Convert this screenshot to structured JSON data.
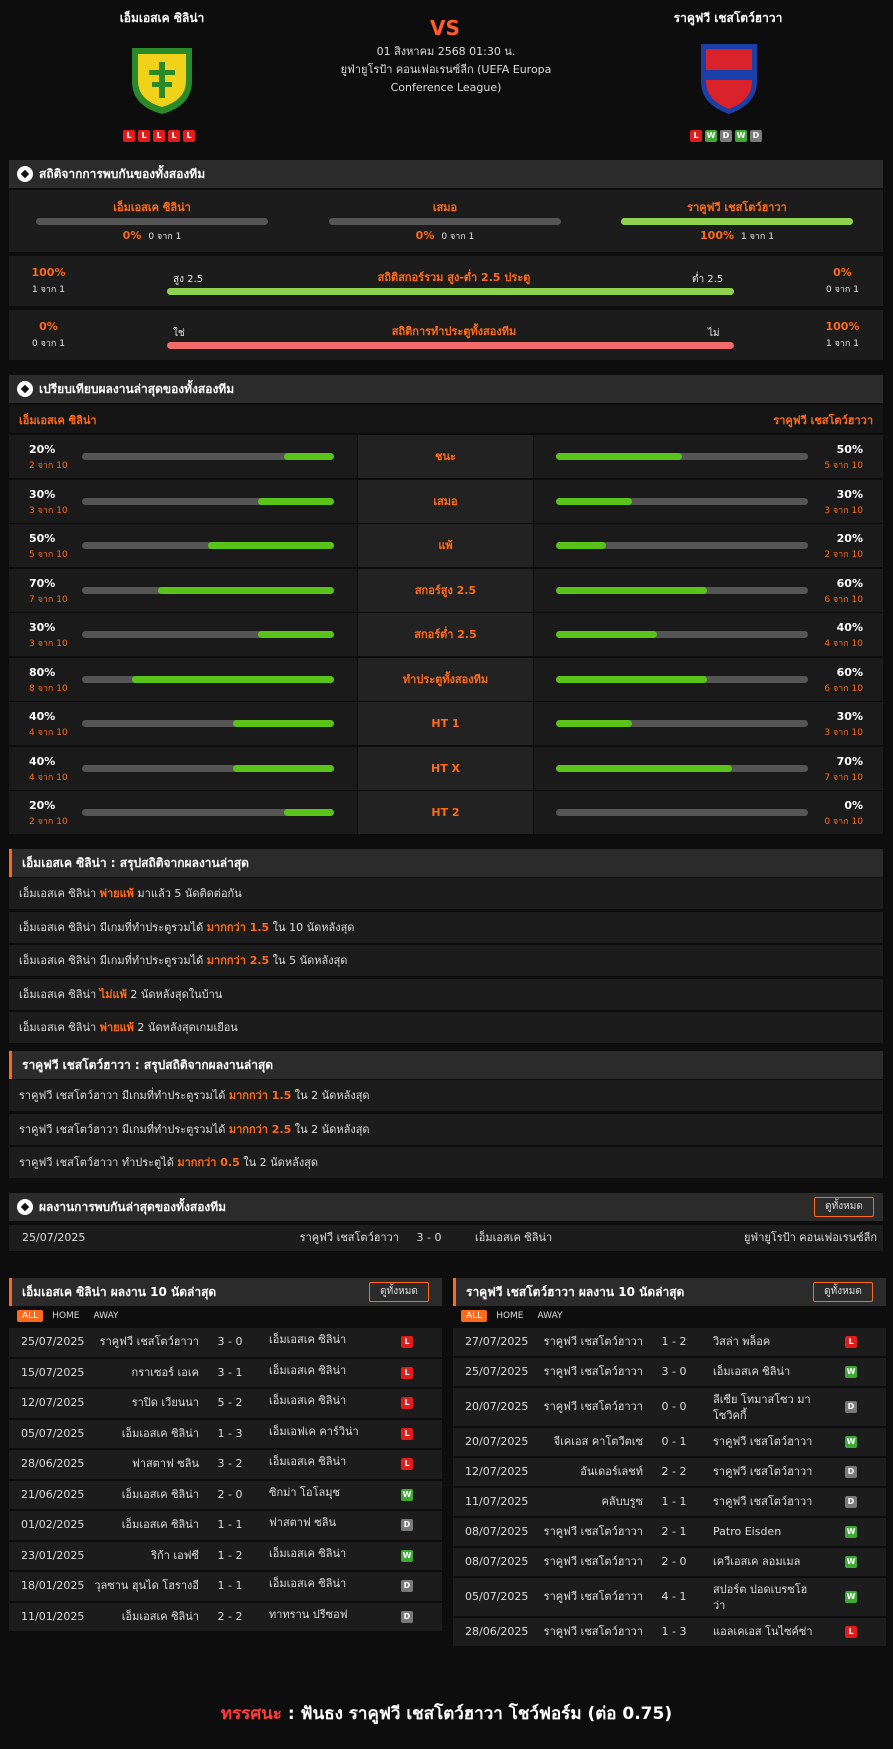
{
  "match": {
    "home": "เอ็มเอสเค ซิลิน่า",
    "away": "ราคูฟวี เชสโตว์ฮาวา",
    "vs": "VS",
    "date": "01 สิงหาคม 2568 01:30 น.",
    "competition": "ยูฟ่ายูโรป้า คอนเฟอเรนซ์ลีก (UEFA Europa Conference League)",
    "home_form": [
      "L",
      "L",
      "L",
      "L",
      "L"
    ],
    "away_form": [
      "L",
      "W",
      "D",
      "W",
      "D"
    ]
  },
  "h2h_stats": {
    "title": "สถิติจากการพบกันของทั้งสองทีม",
    "home": {
      "label": "เอ็มเอสเค ซิลิน่า",
      "pct": "0%",
      "of": "0 จาก 1",
      "value": 0
    },
    "draw": {
      "label": "เสมอ",
      "pct": "0%",
      "of": "0 จาก 1",
      "value": 0
    },
    "away": {
      "label": "ราคูฟวี เชสโตว์ฮาวา",
      "pct": "100%",
      "of": "1 จาก 1",
      "value": 1
    },
    "ou": {
      "title": "สถิติสกอร์รวม สูง-ต่ำ 2.5 ประตู",
      "left_label": "สูง 2.5",
      "right_label": "ต่ำ 2.5",
      "left_pct": "100%",
      "left_of": "1 จาก 1",
      "right_pct": "0%",
      "right_of": "0 จาก 1",
      "value": 1
    },
    "btts": {
      "title": "สถิติการทำประตูทั้งสองทีม",
      "left_label": "ใช่",
      "right_label": "ไม่",
      "left_pct": "0%",
      "left_of": "0 จาก 1",
      "right_pct": "100%",
      "right_of": "1 จาก 1",
      "value": 0
    }
  },
  "compare": {
    "title": "เปรียบเทียบผลงานล่าสุดของทั้งสองทีม",
    "home": "เอ็มเอสเค ซิลิน่า",
    "away": "ราคูฟวี เชสโตว์ฮาวา",
    "rows": [
      {
        "label": "ชนะ",
        "hp": "20%",
        "ho": "2 จาก 10",
        "hv": 0.2,
        "ap": "50%",
        "ao": "5 จาก 10",
        "av": 0.5
      },
      {
        "label": "เสมอ",
        "hp": "30%",
        "ho": "3 จาก 10",
        "hv": 0.3,
        "ap": "30%",
        "ao": "3 จาก 10",
        "av": 0.3
      },
      {
        "label": "แพ้",
        "hp": "50%",
        "ho": "5 จาก 10",
        "hv": 0.5,
        "ap": "20%",
        "ao": "2 จาก 10",
        "av": 0.2
      },
      {
        "label": "สกอร์สูง 2.5",
        "hp": "70%",
        "ho": "7 จาก 10",
        "hv": 0.7,
        "ap": "60%",
        "ao": "6 จาก 10",
        "av": 0.6
      },
      {
        "label": "สกอร์ต่ำ 2.5",
        "hp": "30%",
        "ho": "3 จาก 10",
        "hv": 0.3,
        "ap": "40%",
        "ao": "4 จาก 10",
        "av": 0.4
      },
      {
        "label": "ทำประตูทั้งสองทีม",
        "hp": "80%",
        "ho": "8 จาก 10",
        "hv": 0.8,
        "ap": "60%",
        "ao": "6 จาก 10",
        "av": 0.6
      },
      {
        "label": "HT 1",
        "hp": "40%",
        "ho": "4 จาก 10",
        "hv": 0.4,
        "ap": "30%",
        "ao": "3 จาก 10",
        "av": 0.3
      },
      {
        "label": "HT X",
        "hp": "40%",
        "ho": "4 จาก 10",
        "hv": 0.4,
        "ap": "70%",
        "ao": "7 จาก 10",
        "av": 0.7
      },
      {
        "label": "HT 2",
        "hp": "20%",
        "ho": "2 จาก 10",
        "hv": 0.2,
        "ap": "0%",
        "ao": "0 จาก 10",
        "av": 0
      }
    ]
  },
  "home_summary": {
    "title": "เอ็มเอสเค ซิลิน่า : สรุปสถิติจากผลงานล่าสุด",
    "rows": [
      {
        "pre": "เอ็มเอสเค ซิลิน่า ",
        "hl": "พ่ายแพ้",
        "post": " มาแล้ว 5 นัดติดต่อกัน"
      },
      {
        "pre": "เอ็มเอสเค ซิลิน่า มีเกมที่ทำประตูรวมได้ ",
        "hl": "มากกว่า 1.5",
        "post": " ใน 10 นัดหลังสุด"
      },
      {
        "pre": "เอ็มเอสเค ซิลิน่า มีเกมที่ทำประตูรวมได้ ",
        "hl": "มากกว่า 2.5",
        "post": " ใน 5 นัดหลังสุด"
      },
      {
        "pre": "เอ็มเอสเค ซิลิน่า ",
        "hl": "ไม่แพ้",
        "post": " 2 นัดหลังสุดในบ้าน"
      },
      {
        "pre": "เอ็มเอสเค ซิลิน่า ",
        "hl": "พ่ายแพ้",
        "post": " 2 นัดหลังสุดเกมเยือน"
      }
    ]
  },
  "away_summary": {
    "title": "ราคูฟวี เชสโตว์ฮาวา : สรุปสถิติจากผลงานล่าสุด",
    "rows": [
      {
        "pre": "ราคูฟวี เชสโตว์ฮาวา มีเกมที่ทำประตูรวมได้ ",
        "hl": "มากกว่า 1.5",
        "post": " ใน 2 นัดหลังสุด"
      },
      {
        "pre": "ราคูฟวี เชสโตว์ฮาวา มีเกมที่ทำประตูรวมได้ ",
        "hl": "มากกว่า 2.5",
        "post": " ใน 2 นัดหลังสุด"
      },
      {
        "pre": "ราคูฟวี เชสโตว์ฮาวา ทำประตูได้ ",
        "hl": "มากกว่า 0.5",
        "post": " ใน 2 นัดหลังสุด"
      }
    ]
  },
  "h2h": {
    "title": "ผลงานการพบกันล่าสุดของทั้งสองทีม",
    "view_all": "ดูทั้งหมด",
    "rows": [
      {
        "date": "25/07/2025",
        "home": "ราคูฟวี เชสโตว์ฮาวา",
        "score": "3 - 0",
        "away": "เอ็มเอสเค ซิลิน่า",
        "comp": "ยูฟ่ายูโรป้า คอนเฟอเรนซ์ลีก"
      }
    ]
  },
  "home_last10": {
    "title": "เอ็มเอสเค ซิลิน่า ผลงาน 10 นัดล่าสุด",
    "view_all": "ดูทั้งหมด",
    "tabs": [
      "ALL",
      "HOME",
      "AWAY"
    ],
    "rows": [
      {
        "date": "25/07/2025",
        "home": "ราคูฟวี เชสโตว์ฮาวา",
        "score": "3 - 0",
        "away": "เอ็มเอสเค ซิลิน่า",
        "res": "L"
      },
      {
        "date": "15/07/2025",
        "home": "กราเซอร์ เอเค",
        "score": "3 - 1",
        "away": "เอ็มเอสเค ซิลิน่า",
        "res": "L"
      },
      {
        "date": "12/07/2025",
        "home": "ราปิด เวียนนา",
        "score": "5 - 2",
        "away": "เอ็มเอสเค ซิลิน่า",
        "res": "L"
      },
      {
        "date": "05/07/2025",
        "home": "เอ็มเอสเค ซิลิน่า",
        "score": "1 - 3",
        "away": "เอ็มเอฟเค คาร์วิน่า",
        "res": "L"
      },
      {
        "date": "28/06/2025",
        "home": "ฟาสตาฟ ซลิน",
        "score": "3 - 2",
        "away": "เอ็มเอสเค ซิลิน่า",
        "res": "L"
      },
      {
        "date": "21/06/2025",
        "home": "เอ็มเอสเค ซิลิน่า",
        "score": "2 - 0",
        "away": "ซิกม่า โอโลมุช",
        "res": "W"
      },
      {
        "date": "01/02/2025",
        "home": "เอ็มเอสเค ซิลิน่า",
        "score": "1 - 1",
        "away": "ฟาสตาฟ ซลิน",
        "res": "D"
      },
      {
        "date": "23/01/2025",
        "home": "ริก้า เอฟซี",
        "score": "1 - 2",
        "away": "เอ็มเอสเค ซิลิน่า",
        "res": "W"
      },
      {
        "date": "18/01/2025",
        "home": "วุลซาน ฮุนได โฮรางอี",
        "score": "1 - 1",
        "away": "เอ็มเอสเค ซิลิน่า",
        "res": "D"
      },
      {
        "date": "11/01/2025",
        "home": "เอ็มเอสเค ซิลิน่า",
        "score": "2 - 2",
        "away": "ทาทราน ปรีซอฟ",
        "res": "D"
      }
    ]
  },
  "away_last10": {
    "title": "ราคูฟวี เชสโตว์ฮาวา ผลงาน 10 นัดล่าสุด",
    "view_all": "ดูทั้งหมด",
    "tabs": [
      "ALL",
      "HOME",
      "AWAY"
    ],
    "rows": [
      {
        "date": "27/07/2025",
        "home": "ราคูฟวี เชสโตว์ฮาวา",
        "score": "1 - 2",
        "away": "วิสล่า พล็อค",
        "res": "L"
      },
      {
        "date": "25/07/2025",
        "home": "ราคูฟวี เชสโตว์ฮาวา",
        "score": "3 - 0",
        "away": "เอ็มเอสเค ซิลิน่า",
        "res": "W"
      },
      {
        "date": "20/07/2025",
        "home": "ราคูฟวี เชสโตว์ฮาวา",
        "score": "0 - 0",
        "away": "ลีเซีย โทมาสโซว มาโซวิคกี้",
        "res": "D"
      },
      {
        "date": "20/07/2025",
        "home": "จีเคเอส คาโตวีตเซ",
        "score": "0 - 1",
        "away": "ราคูฟวี เชสโตว์ฮาวา",
        "res": "W"
      },
      {
        "date": "12/07/2025",
        "home": "อันเดอร์เลชท์",
        "score": "2 - 2",
        "away": "ราคูฟวี เชสโตว์ฮาวา",
        "res": "D"
      },
      {
        "date": "11/07/2025",
        "home": "คลับบรูซ",
        "score": "1 - 1",
        "away": "ราคูฟวี เชสโตว์ฮาวา",
        "res": "D"
      },
      {
        "date": "08/07/2025",
        "home": "ราคูฟวี เชสโตว์ฮาวา",
        "score": "2 - 1",
        "away": "Patro Eisden",
        "res": "W"
      },
      {
        "date": "08/07/2025",
        "home": "ราคูฟวี เชสโตว์ฮาวา",
        "score": "2 - 0",
        "away": "เควีเอสเค ลอมเมล",
        "res": "W"
      },
      {
        "date": "05/07/2025",
        "home": "ราคูฟวี เชสโตว์ฮาวา",
        "score": "4 - 1",
        "away": "สปอร์ต ปอดเบรซโฮว่า",
        "res": "W"
      },
      {
        "date": "28/06/2025",
        "home": "ราคูฟวี เชสโตว์ฮาวา",
        "score": "1 - 3",
        "away": "แอลเคเอส โนไซค์ซ่า",
        "res": "L"
      }
    ]
  },
  "verdict": {
    "label": "ทรรศนะ",
    "sep": " : ",
    "text": "ฟันธง ราคูฟวี เชสโตว์ฮาวา โชว์ฟอร์ม (ต่อ 0.75)"
  },
  "colors": {
    "accent": "#ff6a1a",
    "win_bar": "#5ac31a",
    "lose_bar": "#f26a6a",
    "bg": "#0d0d0d"
  }
}
